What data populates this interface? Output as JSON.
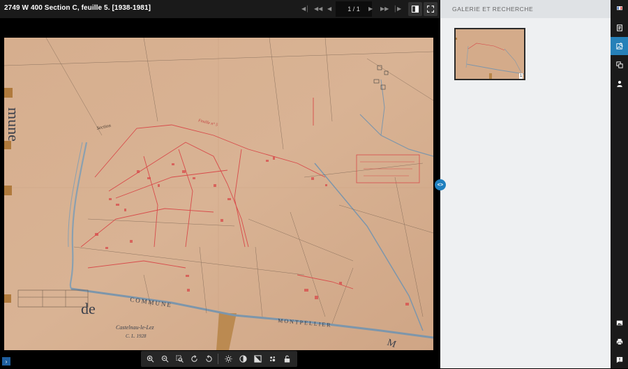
{
  "window": {
    "title": "2749 W 400 Section C, feuille 5. [1938-1981]"
  },
  "navigation": {
    "first_icon": "skip-first-icon",
    "prev_fast_icon": "rewind-icon",
    "prev_icon": "prev-icon",
    "page_current": "1",
    "page_total": "/ 1",
    "next_icon": "next-icon",
    "next_fast_icon": "fast-forward-icon",
    "last_icon": "skip-last-icon"
  },
  "map": {
    "labels": {
      "commune_left": "mune",
      "section": "Section",
      "feuille": "Feuille n° 5",
      "de": "de",
      "commune_bottom": "COMMUNE",
      "montpellier": "MONTPELLIER",
      "m_right": "M",
      "town": "Castelnau-le-Lez",
      "small_note": "C. L. 1928"
    }
  },
  "toolbar_bottom": {
    "tools": [
      "zoom-in-icon",
      "zoom-out-icon",
      "zoom-area-icon",
      "rotate-right-icon",
      "rotate-left-icon",
      "brightness-icon",
      "contrast-icon",
      "invert-icon",
      "color-icon",
      "lock-icon"
    ]
  },
  "gallery": {
    "title": "GALERIE ET RECHERCHE",
    "thumbnail_number": "1"
  },
  "toggle": {
    "label": "<>"
  },
  "corner_button": {
    "label": "›"
  },
  "colors": {
    "accent": "#2680b8",
    "paper": "#d4ab8a",
    "parcel_red": "#d84a4a"
  }
}
